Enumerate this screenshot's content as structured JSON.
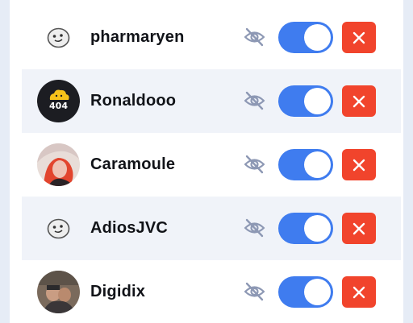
{
  "users": [
    {
      "name": "pharmaryen",
      "avatar": "default-face"
    },
    {
      "name": "Ronaldooo",
      "avatar": "404-cloud-logo",
      "avatar_text": "404"
    },
    {
      "name": "Caramoule",
      "avatar": "photo"
    },
    {
      "name": "AdiosJVC",
      "avatar": "default-face"
    },
    {
      "name": "Digidix",
      "avatar": "photo"
    }
  ],
  "icons": {
    "visibility": "eye-off-icon",
    "delete": "close-icon"
  },
  "colors": {
    "toggle_on": "#3f7cef",
    "delete": "#f1442c",
    "alt_row": "#f0f3f9",
    "eye_icon": "#8d98b4"
  },
  "toggles": [
    true,
    true,
    true,
    true,
    true
  ]
}
